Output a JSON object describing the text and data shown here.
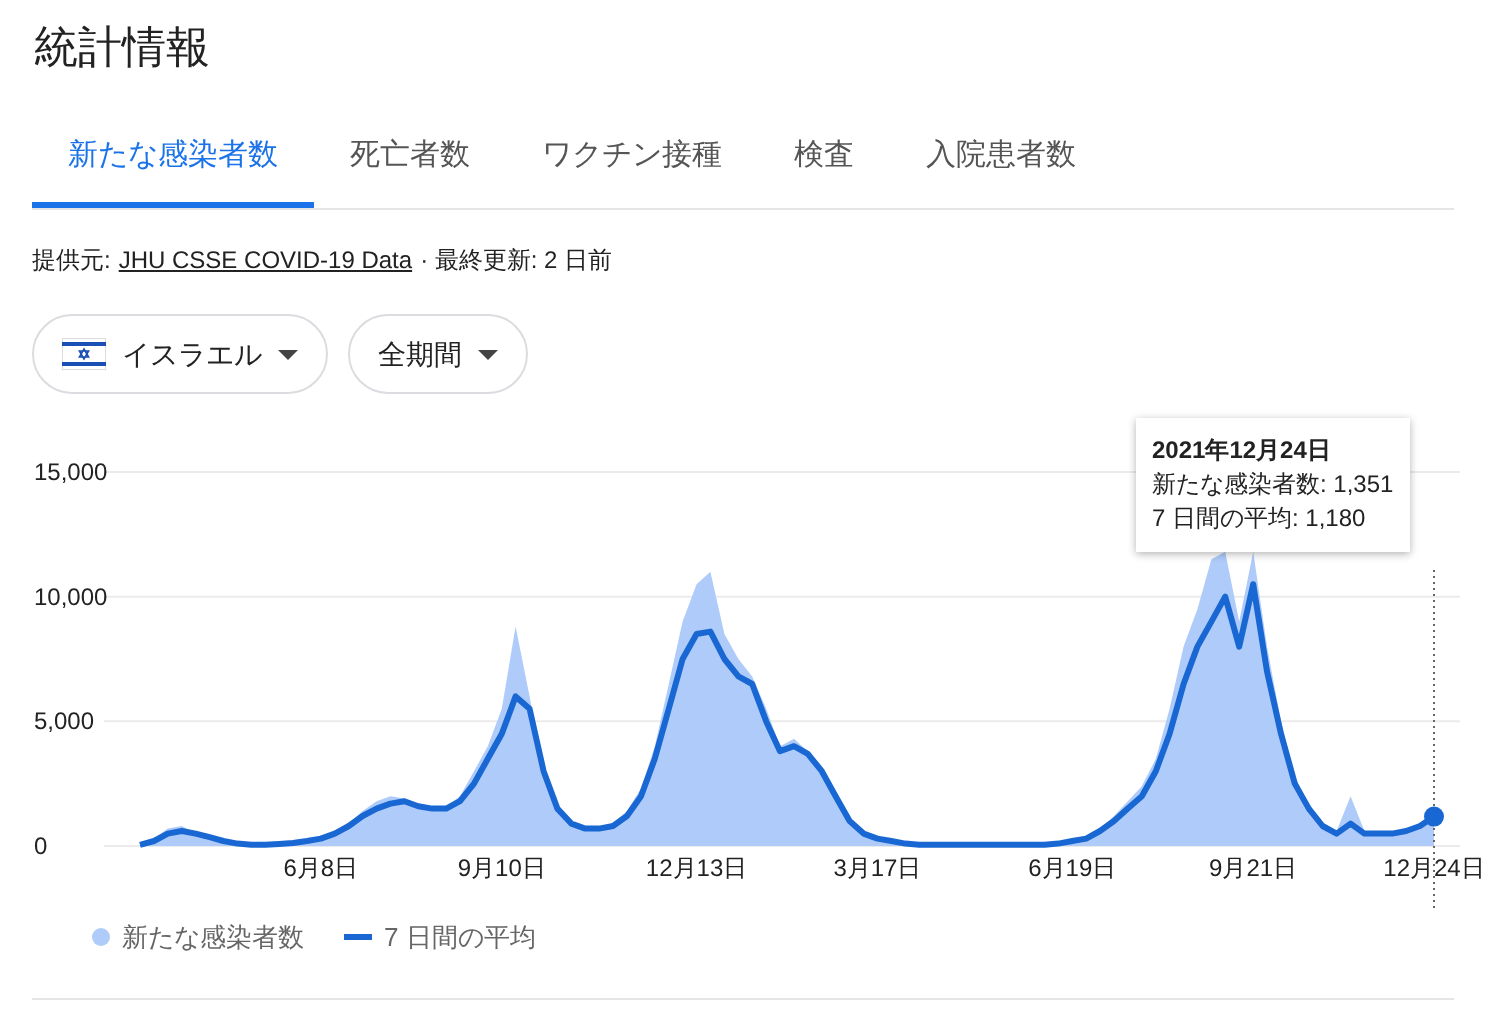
{
  "title": "統計情報",
  "tabs": [
    {
      "label": "新たな感染者数",
      "selected": true
    },
    {
      "label": "死亡者数",
      "selected": false
    },
    {
      "label": "ワクチン接種",
      "selected": false
    },
    {
      "label": "検査",
      "selected": false
    },
    {
      "label": "入院患者数",
      "selected": false
    }
  ],
  "source": {
    "prefix": "提供元:",
    "link": "JHU CSSE COVID-19 Data",
    "updated": "· 最終更新: 2 日前"
  },
  "filters": [
    {
      "label": "イスラエル",
      "kind": "flag"
    },
    {
      "label": "全期間",
      "kind": "plain"
    }
  ],
  "chart": {
    "chart_data": {
      "type": "area",
      "stacked": false,
      "categories": [
        null,
        null,
        null,
        null,
        null,
        null,
        null,
        null,
        null,
        null,
        null,
        null,
        null,
        "6月8日",
        null,
        null,
        null,
        null,
        null,
        null,
        null,
        null,
        null,
        null,
        null,
        null,
        "9月10日",
        null,
        null,
        null,
        null,
        null,
        null,
        null,
        null,
        null,
        null,
        null,
        null,
        null,
        "12月13日",
        null,
        null,
        null,
        null,
        null,
        null,
        null,
        null,
        null,
        null,
        null,
        null,
        "3月17日",
        null,
        null,
        null,
        null,
        null,
        null,
        null,
        null,
        null,
        null,
        null,
        null,
        null,
        "6月19日",
        null,
        null,
        null,
        null,
        null,
        null,
        null,
        null,
        null,
        null,
        null,
        null,
        "9月21日",
        null,
        null,
        null,
        null,
        null,
        null,
        null,
        null,
        null,
        null,
        null,
        null,
        "12月24日"
      ],
      "yticks": [
        {
          "value": 0,
          "label": "0"
        },
        {
          "value": 5000,
          "label": "5,000"
        },
        {
          "value": 10000,
          "label": "10,000"
        },
        {
          "value": 15000,
          "label": "15,000"
        }
      ],
      "ylim": [
        0,
        15000
      ],
      "series": [
        {
          "name": "新たな感染者数",
          "color": "#aecbfa",
          "values": [
            100,
            300,
            700,
            800,
            500,
            300,
            200,
            100,
            50,
            50,
            100,
            150,
            250,
            350,
            600,
            900,
            1400,
            1800,
            2000,
            1900,
            1700,
            1600,
            1600,
            2000,
            3000,
            4000,
            5500,
            8800,
            6000,
            3000,
            1500,
            900,
            700,
            700,
            900,
            1400,
            2300,
            4000,
            6500,
            9000,
            10500,
            11000,
            8500,
            7500,
            6800,
            5500,
            4000,
            4300,
            3800,
            3100,
            2000,
            1000,
            500,
            300,
            200,
            100,
            50,
            50,
            50,
            50,
            50,
            50,
            50,
            50,
            50,
            60,
            120,
            250,
            400,
            700,
            1200,
            1800,
            2400,
            3500,
            5500,
            8000,
            9500,
            11500,
            11800,
            9000,
            11800,
            8000,
            5000,
            2800,
            1600,
            900,
            600,
            2000,
            600,
            600,
            600,
            700,
            900,
            1351
          ]
        },
        {
          "name": "7 日間の平均",
          "type": "line",
          "color": "#1967d2",
          "values": [
            50,
            200,
            500,
            600,
            500,
            350,
            200,
            100,
            50,
            50,
            80,
            120,
            200,
            300,
            500,
            800,
            1200,
            1500,
            1700,
            1800,
            1600,
            1500,
            1500,
            1800,
            2500,
            3500,
            4500,
            6000,
            5500,
            3000,
            1500,
            900,
            700,
            700,
            800,
            1200,
            2000,
            3500,
            5500,
            7500,
            8500,
            8600,
            7500,
            6800,
            6500,
            5000,
            3800,
            4000,
            3700,
            3000,
            2000,
            1000,
            500,
            300,
            200,
            100,
            50,
            50,
            50,
            50,
            50,
            50,
            50,
            50,
            50,
            50,
            100,
            200,
            300,
            600,
            1000,
            1500,
            2000,
            3000,
            4500,
            6500,
            8000,
            9000,
            10000,
            8000,
            10500,
            7000,
            4500,
            2500,
            1500,
            800,
            500,
            900,
            500,
            500,
            500,
            600,
            800,
            1180
          ]
        }
      ]
    },
    "tooltip": {
      "date": "2021年12月24日",
      "lines": [
        "新たな感染者数: 1,351",
        "7 日間の平均: 1,180"
      ]
    }
  }
}
